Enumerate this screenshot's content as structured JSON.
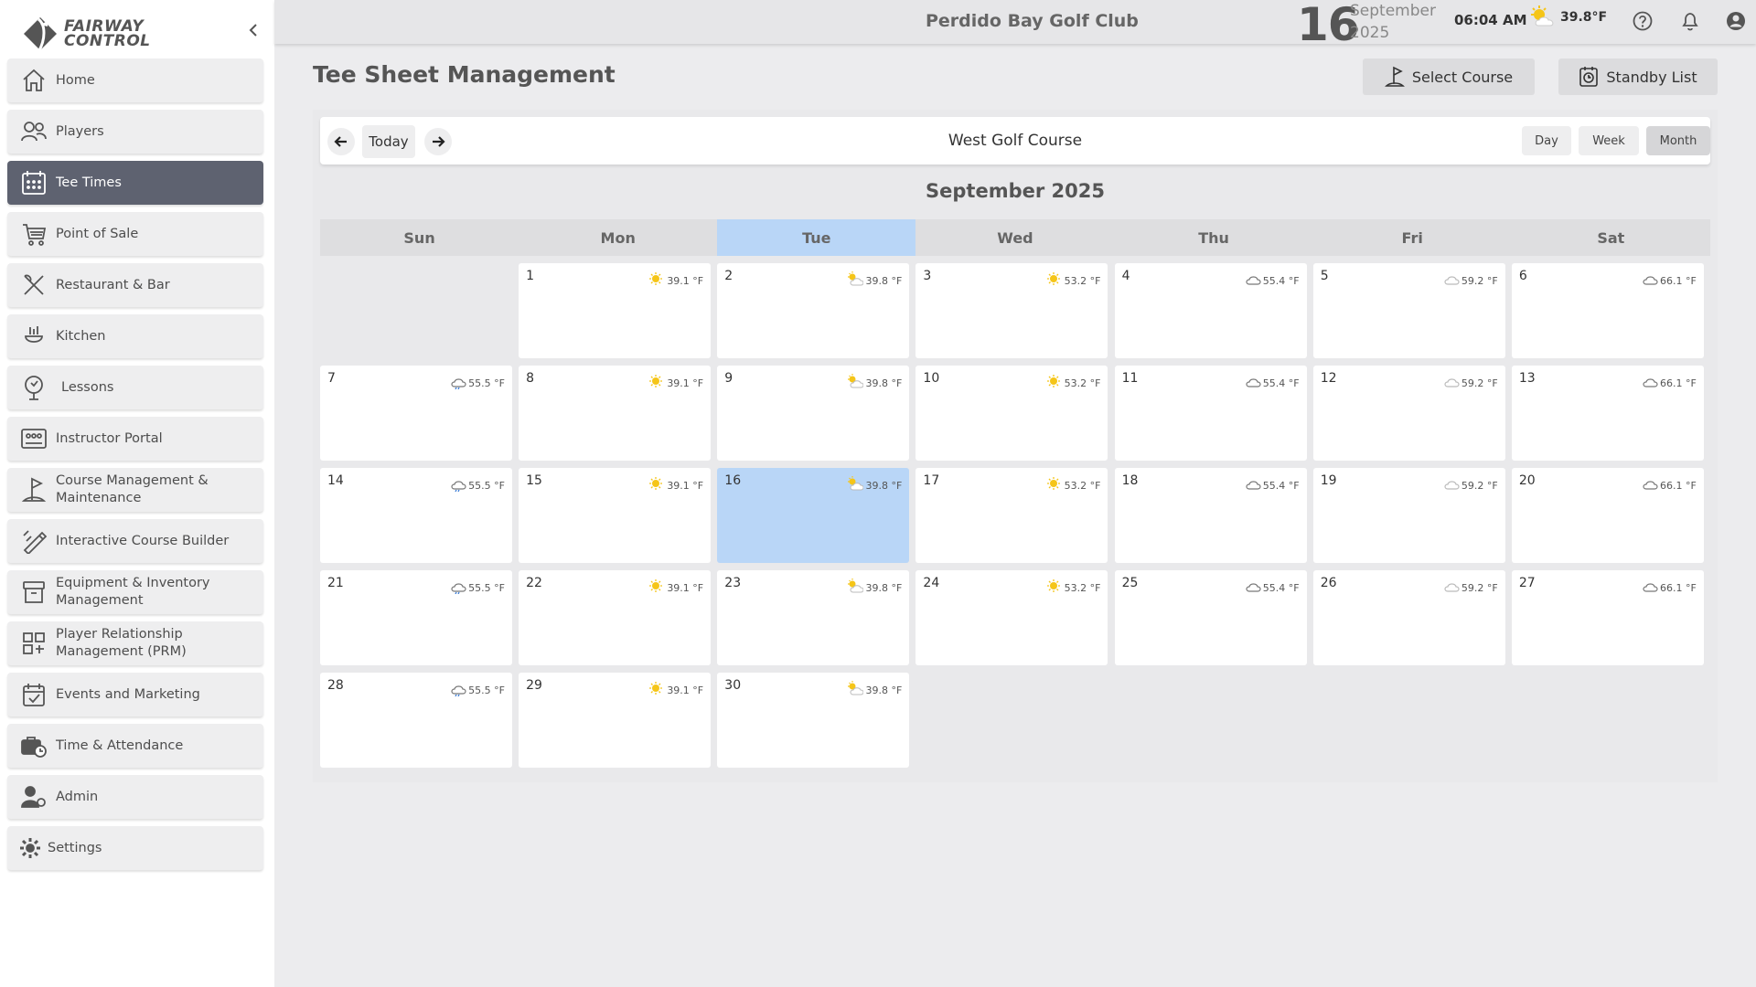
{
  "app": {
    "logo_text_line1": "FAIRWAY",
    "logo_text_line2": "CONTROL"
  },
  "sidebar": {
    "items": [
      {
        "label": "Home",
        "icon": "home-icon"
      },
      {
        "label": "Players",
        "icon": "players-icon"
      },
      {
        "label": "Tee Times",
        "icon": "calendar-grid-icon",
        "active": true
      },
      {
        "label": "Point of Sale",
        "icon": "cart-icon"
      },
      {
        "label": "Restaurant & Bar",
        "icon": "utensils-icon"
      },
      {
        "label": "Kitchen",
        "icon": "kitchen-icon"
      },
      {
        "label": "Lessons",
        "icon": "lessons-icon"
      },
      {
        "label": "Instructor Portal",
        "icon": "instructor-portal-icon"
      },
      {
        "label": "Course Management & Maintenance",
        "icon": "flag-icon"
      },
      {
        "label": "Interactive Course Builder",
        "icon": "builder-icon"
      },
      {
        "label": "Equipment & Inventory Management",
        "icon": "inventory-icon"
      },
      {
        "label": "Player Relationship Management (PRM)",
        "icon": "prm-icon"
      },
      {
        "label": "Events and Marketing",
        "icon": "events-icon"
      },
      {
        "label": "Time & Attendance",
        "icon": "time-attendance-icon"
      },
      {
        "label": "Admin",
        "icon": "admin-icon"
      },
      {
        "label": "Settings",
        "icon": "gear-icon"
      }
    ]
  },
  "topbar": {
    "club_name": "Perdido Bay Golf Club",
    "day": "16",
    "month": "September",
    "year": "2025",
    "time": "06:04  AM",
    "temperature": "39.8°F",
    "weather_icon": "partly-sunny-icon"
  },
  "main": {
    "title": "Tee Sheet Management",
    "select_course_label": "Select Course",
    "standby_list_label": "Standby List"
  },
  "calendar": {
    "today_label": "Today",
    "course_name": "West Golf Course",
    "views": [
      "Day",
      "Week",
      "Month"
    ],
    "active_view": "Month",
    "month_title": "September 2025",
    "weekdays": [
      "Sun",
      "Mon",
      "Tue",
      "Wed",
      "Thu",
      "Fri",
      "Sat"
    ],
    "today_weekday_index": 2,
    "today_date": 16,
    "start_offset": 1,
    "days": [
      {
        "d": "1",
        "temp": "39.1 °F",
        "w": "sun"
      },
      {
        "d": "2",
        "temp": "39.8 °F",
        "w": "partly"
      },
      {
        "d": "3",
        "temp": "53.2 °F",
        "w": "sun"
      },
      {
        "d": "4",
        "temp": "55.4 °F",
        "w": "cloud"
      },
      {
        "d": "5",
        "temp": "59.2 °F",
        "w": "cloud-light"
      },
      {
        "d": "6",
        "temp": "66.1 °F",
        "w": "cloud"
      },
      {
        "d": "7",
        "temp": "55.5 °F",
        "w": "rain"
      },
      {
        "d": "8",
        "temp": "39.1 °F",
        "w": "sun"
      },
      {
        "d": "9",
        "temp": "39.8 °F",
        "w": "partly"
      },
      {
        "d": "10",
        "temp": "53.2 °F",
        "w": "sun"
      },
      {
        "d": "11",
        "temp": "55.4 °F",
        "w": "cloud"
      },
      {
        "d": "12",
        "temp": "59.2 °F",
        "w": "cloud-light"
      },
      {
        "d": "13",
        "temp": "66.1 °F",
        "w": "cloud"
      },
      {
        "d": "14",
        "temp": "55.5 °F",
        "w": "rain"
      },
      {
        "d": "15",
        "temp": "39.1 °F",
        "w": "sun"
      },
      {
        "d": "16",
        "temp": "39.8 °F",
        "w": "partly"
      },
      {
        "d": "17",
        "temp": "53.2 °F",
        "w": "sun"
      },
      {
        "d": "18",
        "temp": "55.4 °F",
        "w": "cloud"
      },
      {
        "d": "19",
        "temp": "59.2 °F",
        "w": "cloud-light"
      },
      {
        "d": "20",
        "temp": "66.1 °F",
        "w": "cloud"
      },
      {
        "d": "21",
        "temp": "55.5 °F",
        "w": "rain"
      },
      {
        "d": "22",
        "temp": "39.1 °F",
        "w": "sun"
      },
      {
        "d": "23",
        "temp": "39.8 °F",
        "w": "partly"
      },
      {
        "d": "24",
        "temp": "53.2 °F",
        "w": "sun"
      },
      {
        "d": "25",
        "temp": "55.4 °F",
        "w": "cloud"
      },
      {
        "d": "26",
        "temp": "59.2 °F",
        "w": "cloud-light"
      },
      {
        "d": "27",
        "temp": "66.1 °F",
        "w": "cloud"
      },
      {
        "d": "28",
        "temp": "55.5 °F",
        "w": "rain"
      },
      {
        "d": "29",
        "temp": "39.1 °F",
        "w": "sun"
      },
      {
        "d": "30",
        "temp": "39.8 °F",
        "w": "partly"
      }
    ]
  }
}
